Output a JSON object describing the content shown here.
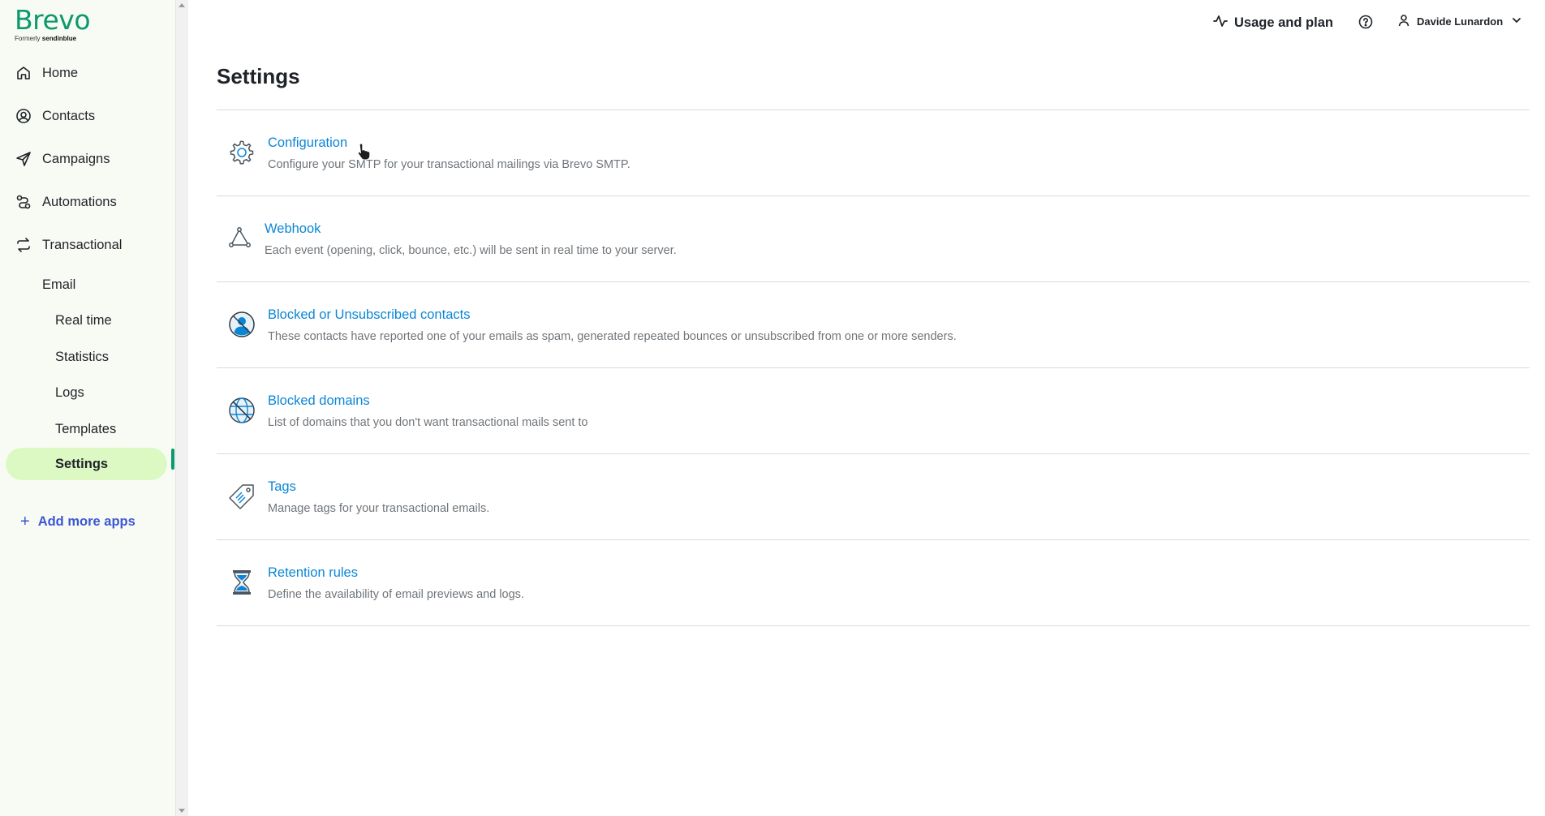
{
  "brand": {
    "name": "Brevo",
    "formerly_prefix": "Formerly",
    "formerly_name": "sendinblue",
    "color": "#0b996e"
  },
  "sidebar": {
    "items": [
      {
        "label": "Home",
        "icon": "home-icon"
      },
      {
        "label": "Contacts",
        "icon": "contacts-icon"
      },
      {
        "label": "Campaigns",
        "icon": "send-icon"
      },
      {
        "label": "Automations",
        "icon": "automations-icon"
      },
      {
        "label": "Transactional",
        "icon": "transactional-icon"
      }
    ],
    "email_label": "Email",
    "subitems": [
      "Real time",
      "Statistics",
      "Logs",
      "Templates",
      "Settings"
    ],
    "active": "Settings",
    "add_more": "Add more apps"
  },
  "header": {
    "usage_label": "Usage and plan",
    "help_icon": "help-circle-icon",
    "user_name": "Davide Lunardon"
  },
  "page": {
    "title": "Settings",
    "rows": [
      {
        "title": "Configuration",
        "desc": "Configure your SMTP for your transactional mailings via Brevo SMTP.",
        "icon": "gear-icon"
      },
      {
        "title": "Webhook",
        "desc": "Each event (opening, click, bounce, etc.) will be sent in real time to your server.",
        "icon": "webhook-icon"
      },
      {
        "title": "Blocked or Unsubscribed contacts",
        "desc": "These contacts have reported one of your emails as spam, generated repeated bounces or unsubscribed from one or more senders.",
        "icon": "blocked-user-icon"
      },
      {
        "title": "Blocked domains",
        "desc": "List of domains that you don't want transactional mails sent to",
        "icon": "blocked-globe-icon"
      },
      {
        "title": "Tags",
        "desc": "Manage tags for your transactional emails.",
        "icon": "tag-icon"
      },
      {
        "title": "Retention rules",
        "desc": "Define the availability of email previews and logs.",
        "icon": "hourglass-icon"
      }
    ]
  },
  "colors": {
    "link": "#0a86d6",
    "active_bg": "#dcf9c3",
    "add_more": "#3c57d2",
    "sidebar_bg": "#f8fbf4"
  }
}
